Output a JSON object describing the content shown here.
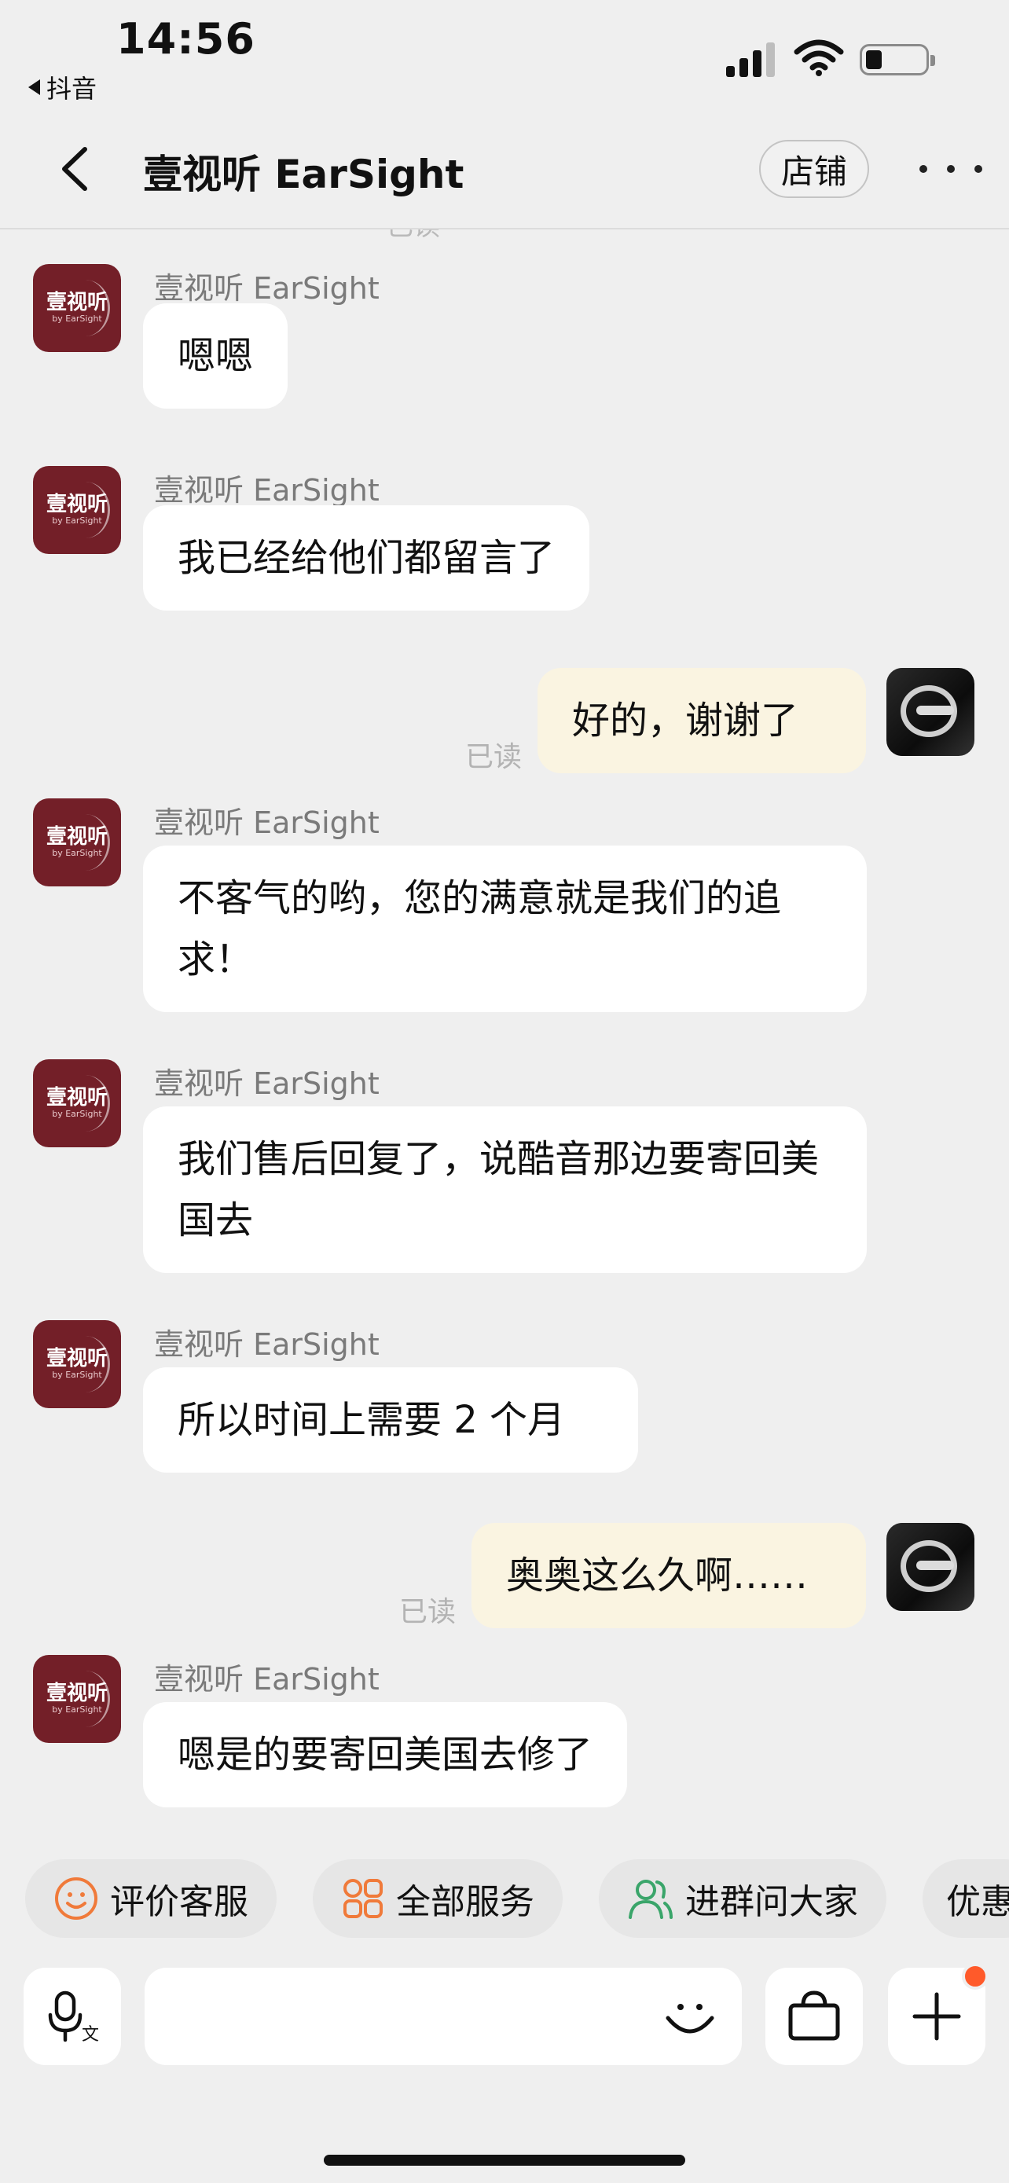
{
  "status_bar": {
    "time": "14:56",
    "back_app_label": "抖音",
    "icons": [
      "signal-icon",
      "wifi-icon",
      "battery-icon"
    ]
  },
  "header": {
    "title": "壹视听 EarSight",
    "shop_label": "店铺",
    "back_icon": "chevron-left-icon",
    "more_icon": "more-dots-icon"
  },
  "chat": {
    "shop_logo_text": "壹视听",
    "shop_logo_sub": "by EarSight",
    "partial_read": "已读",
    "messages": [
      {
        "side": "in",
        "sender": "壹视听 EarSight",
        "text": "嗯嗯"
      },
      {
        "side": "in",
        "sender": "壹视听 EarSight",
        "text": "我已经给他们都留言了"
      },
      {
        "side": "out",
        "text": "好的，谢谢了",
        "read": "已读"
      },
      {
        "side": "in",
        "sender": "壹视听 EarSight",
        "text": "不客气的哟，您的满意就是我们的追求！"
      },
      {
        "side": "in",
        "sender": "壹视听 EarSight",
        "text": "我们售后回复了，说酷音那边要寄回美国去"
      },
      {
        "side": "in",
        "sender": "壹视听 EarSight",
        "text": "所以时间上需要 2 个月"
      },
      {
        "side": "out",
        "text": "奥奥这么久啊……",
        "read": "已读"
      },
      {
        "side": "in",
        "sender": "壹视听 EarSight",
        "text": "嗯是的要寄回美国去修了"
      }
    ]
  },
  "quick_actions": [
    {
      "label": "评价客服",
      "icon": "smiley-icon",
      "color": "#f07a3a"
    },
    {
      "label": "全部服务",
      "icon": "grid-icon",
      "color": "#f07a3a"
    },
    {
      "label": "进群问大家",
      "icon": "group-icon",
      "color": "#3aa56a"
    },
    {
      "label": "优惠",
      "icon": "coupon-icon",
      "color": "#f07a3a"
    }
  ],
  "input_bar": {
    "voice_icon": "voice-translate-icon",
    "placeholder": "",
    "emoji_icon": "emoji-icon",
    "bag_icon": "shopping-bag-icon",
    "plus_icon": "plus-icon",
    "badge_color": "#ff5a2a"
  }
}
